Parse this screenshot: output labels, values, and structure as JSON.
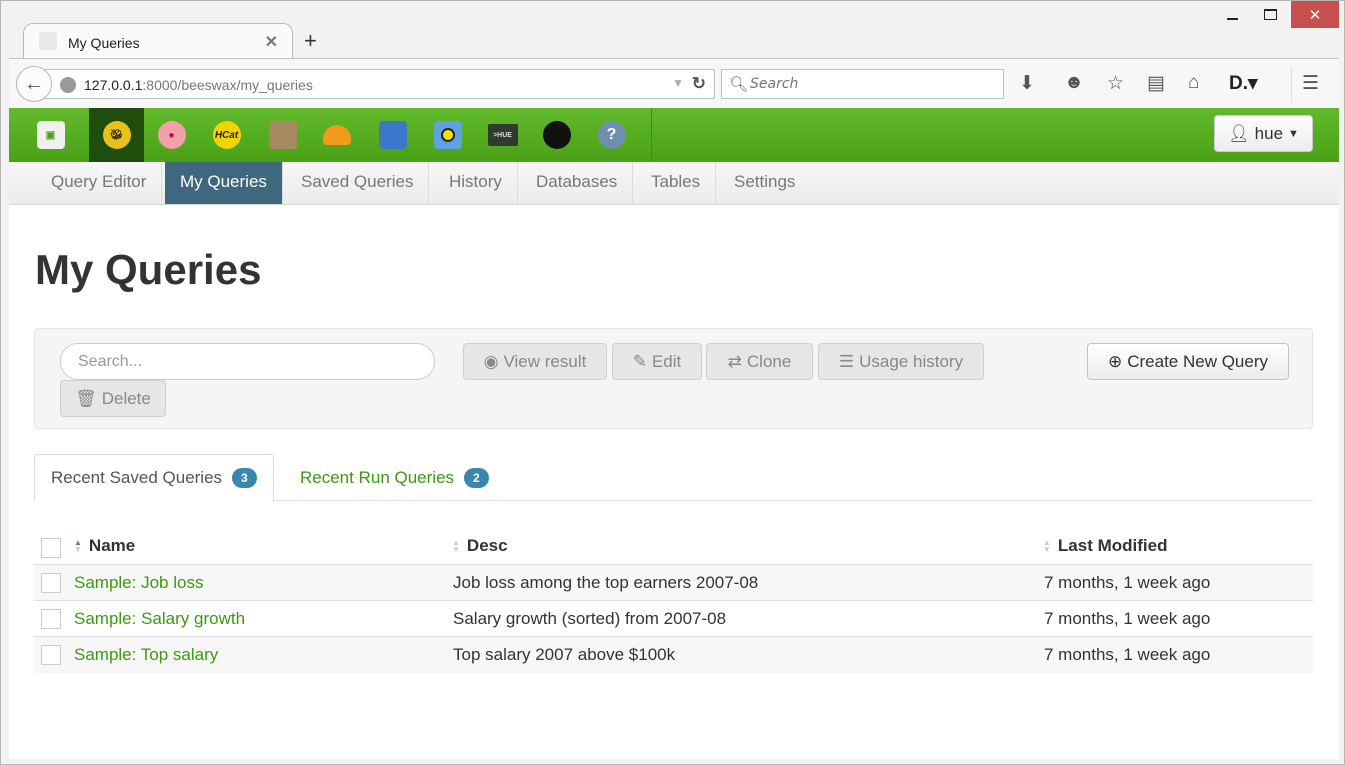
{
  "browser": {
    "tab_title": "My Queries",
    "url_host": "127.0.0.1",
    "url_rest": ":8000/beeswax/my_queries",
    "search_placeholder": "Search",
    "window_controls": {
      "minimize": "minimize",
      "maximize": "maximize",
      "close": "✕"
    },
    "toolbar_icons": [
      "download-icon",
      "hello-icon",
      "bookmark-star-icon",
      "reading-list-icon",
      "home-icon",
      "dashlane-icon",
      "menu-icon"
    ]
  },
  "app": {
    "brand_color": "#4aa116",
    "apps": [
      {
        "name": "hue-home",
        "label": ""
      },
      {
        "name": "beeswax-hive",
        "label": ""
      },
      {
        "name": "pig",
        "label": ""
      },
      {
        "name": "hcatalog",
        "label": "HCat"
      },
      {
        "name": "file-browser",
        "label": ""
      },
      {
        "name": "job-designer",
        "label": ""
      },
      {
        "name": "oozie",
        "label": ""
      },
      {
        "name": "job-browser",
        "label": ""
      },
      {
        "name": "hue-shell",
        "label": ">HUE"
      },
      {
        "name": "user-admin",
        "label": ""
      },
      {
        "name": "help",
        "label": "?"
      }
    ],
    "user_button": "hue"
  },
  "subnav": {
    "items": [
      {
        "label": "Query Editor",
        "active": false
      },
      {
        "label": "My Queries",
        "active": true
      },
      {
        "label": "Saved Queries",
        "active": false
      },
      {
        "label": "History",
        "active": false
      },
      {
        "label": "Databases",
        "active": false
      },
      {
        "label": "Tables",
        "active": false
      },
      {
        "label": "Settings",
        "active": false
      }
    ]
  },
  "page_title": "My Queries",
  "toolbar": {
    "search_placeholder": "Search...",
    "view_result": "View result",
    "edit": "Edit",
    "clone": "Clone",
    "usage_history": "Usage history",
    "delete": "Delete",
    "create_new": "Create New Query"
  },
  "tabs": [
    {
      "label": "Recent Saved Queries",
      "count": "3",
      "active": true
    },
    {
      "label": "Recent Run Queries",
      "count": "2",
      "active": false
    }
  ],
  "table": {
    "columns": [
      "Name",
      "Desc",
      "Last Modified"
    ],
    "sort_column": "Name",
    "rows": [
      {
        "name": "Sample: Job loss",
        "desc": "Job loss among the top earners 2007-08",
        "modified": "7 months, 1 week ago"
      },
      {
        "name": "Sample: Salary growth",
        "desc": "Salary growth (sorted) from 2007-08",
        "modified": "7 months, 1 week ago"
      },
      {
        "name": "Sample: Top salary",
        "desc": "Top salary 2007 above $100k",
        "modified": "7 months, 1 week ago"
      }
    ]
  }
}
